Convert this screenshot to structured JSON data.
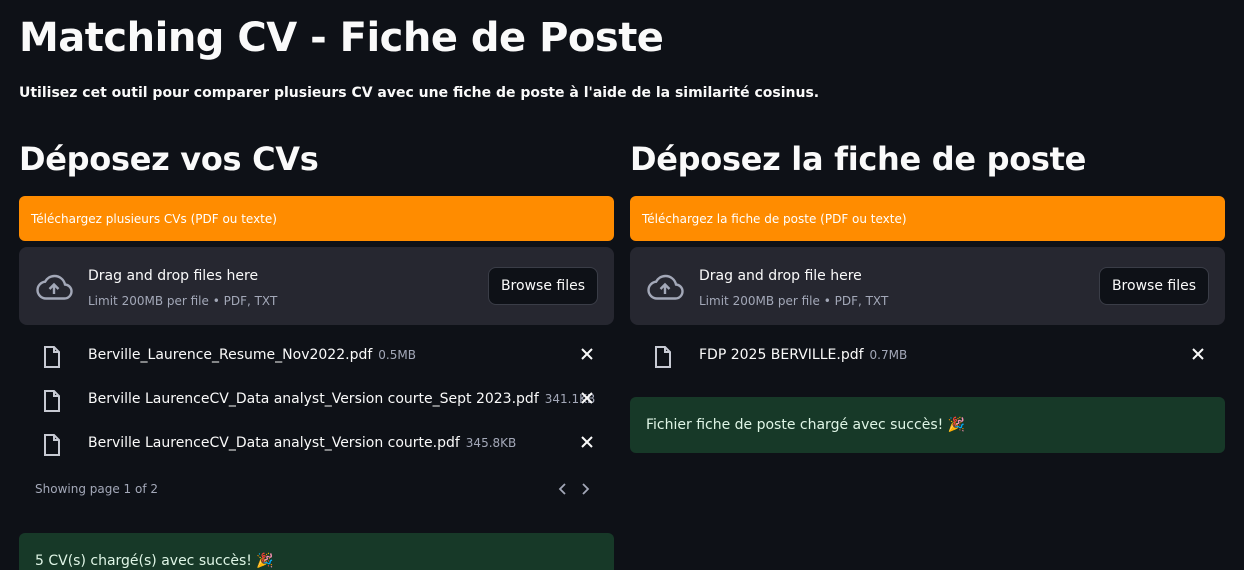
{
  "app": {
    "title": "Matching CV - Fiche de Poste",
    "subtitle": "Utilisez cet outil pour comparer plusieurs CV avec une fiche de poste à l'aide de la similarité cosinus."
  },
  "cv_column": {
    "heading": "Déposez vos CVs",
    "banner": "Téléchargez plusieurs CVs (PDF ou texte)",
    "dropzone": {
      "title": "Drag and drop files here",
      "limit": "Limit 200MB per file • PDF, TXT",
      "browse_label": "Browse files"
    },
    "files": [
      {
        "name": "Berville_Laurence_Resume_Nov2022.pdf",
        "size": "0.5MB"
      },
      {
        "name": "Berville LaurenceCV_Data analyst_Version courte_Sept 2023.pdf",
        "size": "341.1KB"
      },
      {
        "name": "Berville LaurenceCV_Data analyst_Version courte.pdf",
        "size": "345.8KB"
      }
    ],
    "pager": "Showing page 1 of 2",
    "success": "5 CV(s) chargé(s) avec succès! 🎉"
  },
  "job_column": {
    "heading": "Déposez la fiche de poste",
    "banner": "Téléchargez la fiche de poste (PDF ou texte)",
    "dropzone": {
      "title": "Drag and drop file here",
      "limit": "Limit 200MB per file • PDF, TXT",
      "browse_label": "Browse files"
    },
    "files": [
      {
        "name": "FDP 2025 BERVILLE.pdf",
        "size": "0.7MB"
      }
    ],
    "success": "Fichier fiche de poste chargé avec succès! 🎉"
  },
  "colors": {
    "background": "#0e1117",
    "banner": "#ff8c00",
    "dropzone": "#262730",
    "success": "#173928"
  }
}
